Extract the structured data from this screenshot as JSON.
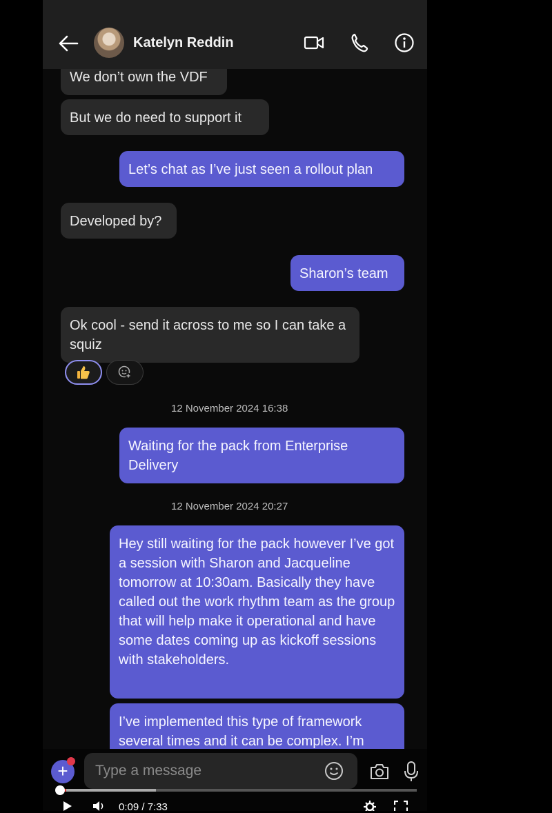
{
  "header": {
    "contact_name": "Katelyn Reddin"
  },
  "messages": [
    {
      "from": "them",
      "text": "We don’t own the VDF"
    },
    {
      "from": "them",
      "text": "But we do need to support it"
    },
    {
      "from": "me",
      "text": "Let’s chat as I’ve just seen a rollout plan"
    },
    {
      "from": "them",
      "text": "Developed by?"
    },
    {
      "from": "me",
      "text": "Sharon’s team"
    },
    {
      "from": "them",
      "text": "Ok cool - send it across to me so I can take a squiz"
    },
    {
      "from": "me",
      "text": "Waiting for the pack from Enterprise Delivery"
    },
    {
      "from": "me",
      "text": "Hey still waiting for the pack however I’ve got a session with Sharon and Jacqueline tomorrow at 10:30am. Basically they have called out the work rhythm team as the group that will help make it operational and have some dates coming up as kickoff sessions with stakeholders."
    },
    {
      "from": "me",
      "text": "I’ve implemented this type of framework several times and it can be complex. I’m"
    }
  ],
  "reactions": {
    "selected": "thumbs-up",
    "add": "add-reaction"
  },
  "timestamps": [
    "12 November 2024 16:38",
    "12 November 2024 20:27"
  ],
  "composer": {
    "placeholder": "Type a message"
  },
  "video": {
    "time": "0:09 / 7:33",
    "progress_fraction": 0.02
  },
  "colors": {
    "accent": "#5b5bd0",
    "incoming": "#292929"
  }
}
